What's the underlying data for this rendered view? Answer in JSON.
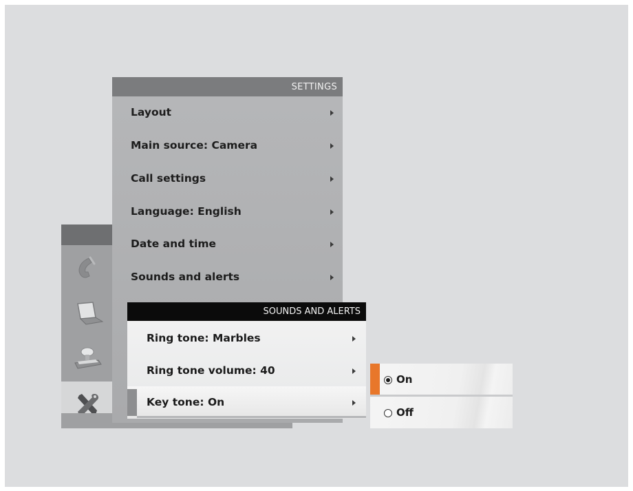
{
  "colors": {
    "accent": "#e8772a",
    "screen_bg": "#dcdddf",
    "settings_bg": "#aeafb1",
    "submenu_header": "#0b0b0b"
  },
  "rail": {
    "icons": [
      "phone-icon",
      "laptop-icon",
      "camera-icon",
      "tools-icon"
    ],
    "active": "tools-icon"
  },
  "settings": {
    "title": "SETTINGS",
    "items": [
      {
        "label": "Layout"
      },
      {
        "label": "Main source: Camera"
      },
      {
        "label": "Call settings"
      },
      {
        "label": "Language: English"
      },
      {
        "label": "Date and time"
      },
      {
        "label": "Sounds and alerts"
      }
    ]
  },
  "sounds": {
    "title": "SOUNDS AND ALERTS",
    "items": [
      {
        "label": "Ring tone: Marbles"
      },
      {
        "label": "Ring tone volume: 40"
      },
      {
        "label": "Key tone: On"
      }
    ],
    "selected": "Key tone: On"
  },
  "options": {
    "items": [
      {
        "label": "On",
        "checked": true
      },
      {
        "label": "Off",
        "checked": false
      }
    ]
  }
}
